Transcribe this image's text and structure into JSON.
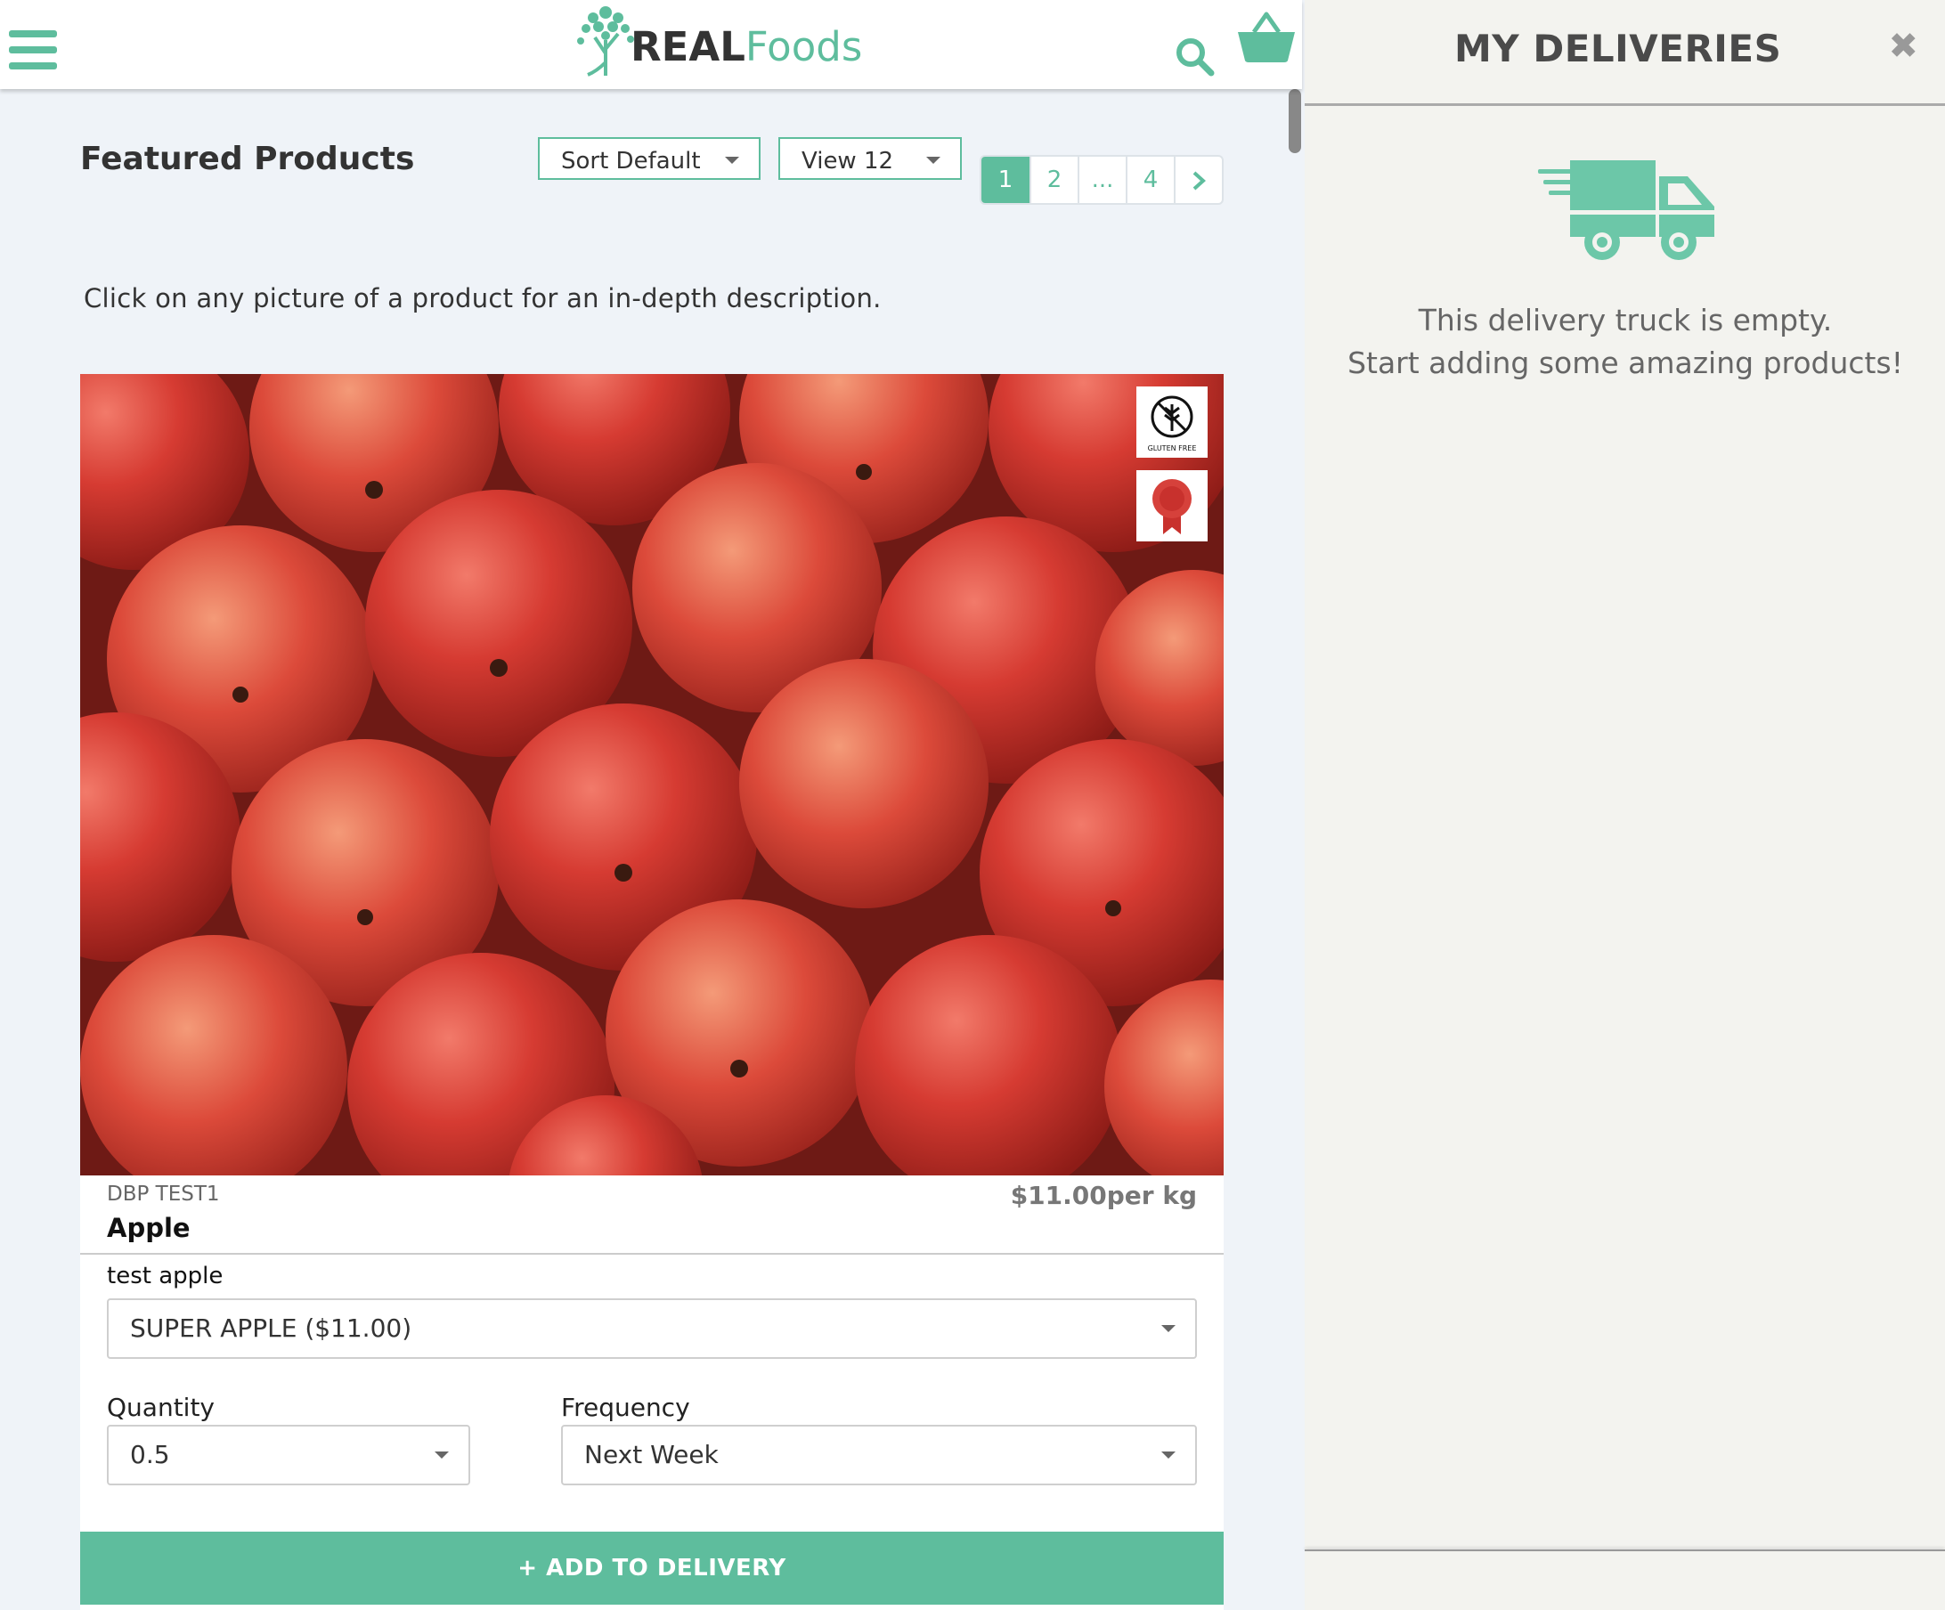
{
  "header": {
    "logo": {
      "brand_bold": "REAL",
      "brand_light": "Foods"
    },
    "menu_icon": "hamburger-menu-icon",
    "search_icon": "search-icon",
    "cart_icon": "basket-icon",
    "accent_color": "#5ebd9d"
  },
  "main": {
    "title": "Featured Products",
    "sort": {
      "selected": "Sort Default"
    },
    "view": {
      "selected": "View 12"
    },
    "pagination": {
      "pages": [
        "1",
        "2",
        "...",
        "4"
      ],
      "active": "1",
      "next_icon": "chevron-right-icon"
    },
    "instructions": "Click on any picture of a product for an in-depth description."
  },
  "product": {
    "image_badges": [
      "gluten-free-badge-icon",
      "award-ribbon-icon"
    ],
    "gluten_free_text": "GLUTEN FREE",
    "code": "DBP TEST1",
    "price": "$11.00per kg",
    "name": "Apple",
    "variant_label": "test apple",
    "variant_selected": "SUPER APPLE ($11.00)",
    "quantity_label": "Quantity",
    "quantity_selected": "0.5",
    "frequency_label": "Frequency",
    "frequency_selected": "Next Week",
    "add_button": "ADD TO DELIVERY"
  },
  "deliveries_panel": {
    "title": "MY DELIVERIES",
    "close_icon": "close-icon",
    "truck_icon": "delivery-truck-icon",
    "empty_line1": "This delivery truck is empty.",
    "empty_line2": "Start adding some amazing products!"
  }
}
